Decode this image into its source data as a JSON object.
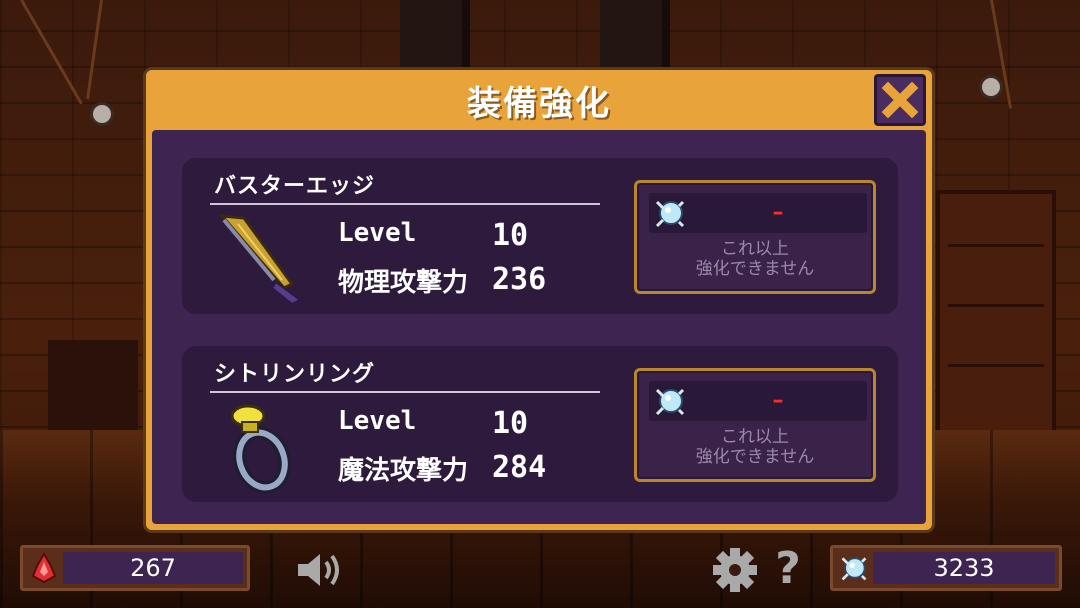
{
  "panel": {
    "title": "装備強化",
    "close_icon": "close-x-icon"
  },
  "items": [
    {
      "name": "バスターエッジ",
      "icon": "sword-icon",
      "level_label": "Level",
      "level_value": "10",
      "stat_label": "物理攻撃力",
      "stat_value": "236",
      "upgrade": {
        "cost_icon": "crystal-gem-icon",
        "cost_value": "–",
        "message": "これ以上\n強化できません"
      }
    },
    {
      "name": "シトリンリング",
      "icon": "ring-icon",
      "level_label": "Level",
      "level_value": "10",
      "stat_label": "魔法攻撃力",
      "stat_value": "284",
      "upgrade": {
        "cost_icon": "crystal-gem-icon",
        "cost_value": "–",
        "message": "これ以上\n強化できません"
      }
    }
  ],
  "hud": {
    "left": {
      "icon": "red-flame-gem-icon",
      "value": "267"
    },
    "sound_icon": "speaker-icon",
    "settings_icon": "gear-icon",
    "help_label": "?",
    "right": {
      "icon": "crystal-gem-icon",
      "value": "3233"
    }
  },
  "colors": {
    "panel_frame": "#e8a33a",
    "panel_body": "#3e2450",
    "card_bg": "#2e1a3c",
    "cost_unavailable": "#ff2a2a",
    "button_border": "#b8872a"
  }
}
